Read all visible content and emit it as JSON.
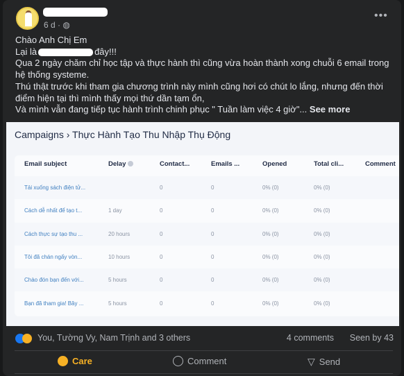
{
  "post": {
    "timestamp": "6 d",
    "audience_icon": "globe-icon",
    "menu_icon": "more-icon",
    "lines": [
      "Chào Anh Chị Em",
      "Lại là",
      "đây!!!",
      "Qua 2 ngày chăm chỉ học tập và thực hành thì cũng vừa hoàn thành xong chuỗi 6 email trong hệ thống systeme.",
      "Thú thật trước khi tham gia chương trình này mình cũng hơi có chút lo lắng, nhưng đến thời điểm hiện tại thì mình thấy mọi thứ dần tạm ổn,",
      "Và mình vẫn đang tiếp tục hành trình chinh phục \" Tuần làm việc 4 giờ\"..."
    ],
    "see_more": "See more"
  },
  "screenshot": {
    "breadcrumb_root": "Campaigns",
    "breadcrumb_sep": "›",
    "breadcrumb_current": "Thực Hành Tạo Thu Nhập Thụ Động",
    "columns": [
      "Email subject",
      "Delay",
      "Contact...",
      "Emails ...",
      "Opened",
      "Total cli...",
      "Comment"
    ],
    "rows": [
      [
        "Tải xuống sách điện tử...",
        "",
        "0",
        "0",
        "0% (0)",
        "0% (0)"
      ],
      [
        "Cách dễ nhất để tạo t...",
        "1 day",
        "0",
        "0",
        "0% (0)",
        "0% (0)"
      ],
      [
        "Cách thực sự tạo thu ...",
        "20 hours",
        "0",
        "0",
        "0% (0)",
        "0% (0)"
      ],
      [
        "Tôi đã chán ngấy vòn...",
        "10 hours",
        "0",
        "0",
        "0% (0)",
        "0% (0)"
      ],
      [
        "Chào đón bạn đến với...",
        "5 hours",
        "0",
        "0",
        "0% (0)",
        "0% (0)"
      ],
      [
        "Bạn đã tham gia! Bây ...",
        "5 hours",
        "0",
        "0",
        "0% (0)",
        "0% (0)"
      ]
    ]
  },
  "stats": {
    "reactions": "You, Tường Vy, Nam Trịnh and 3 others",
    "comments": "4 comments",
    "seen": "Seen by 43"
  },
  "actions": {
    "care": "Care",
    "comment": "Comment",
    "send": "Send"
  },
  "colors": {
    "care": "#f7b125",
    "link": "#3f7fc0",
    "card": "#242526"
  }
}
